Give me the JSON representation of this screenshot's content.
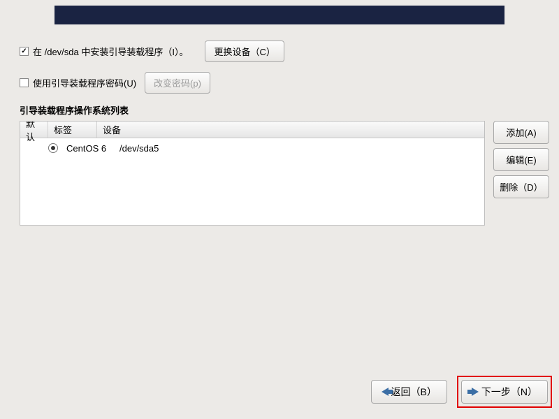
{
  "bootloader": {
    "install_label": "在 /dev/sda 中安装引导装载程序（I）。",
    "change_device_btn": "更换设备（C）",
    "use_password_label": "使用引导装载程序密码(U)",
    "change_password_btn": "改变密码(p)",
    "install_checked": true,
    "password_checked": false
  },
  "os_list": {
    "title": "引导装载程序操作系统列表",
    "columns": {
      "default": "默认",
      "label": "标签",
      "device": "设备"
    },
    "entries": [
      {
        "selected": true,
        "label": "CentOS 6",
        "device": "/dev/sda5"
      }
    ]
  },
  "side_buttons": {
    "add": "添加(A)",
    "edit": "编辑(E)",
    "delete": "删除（D）"
  },
  "nav": {
    "back": "返回（B）",
    "next": "下一步（N）"
  }
}
